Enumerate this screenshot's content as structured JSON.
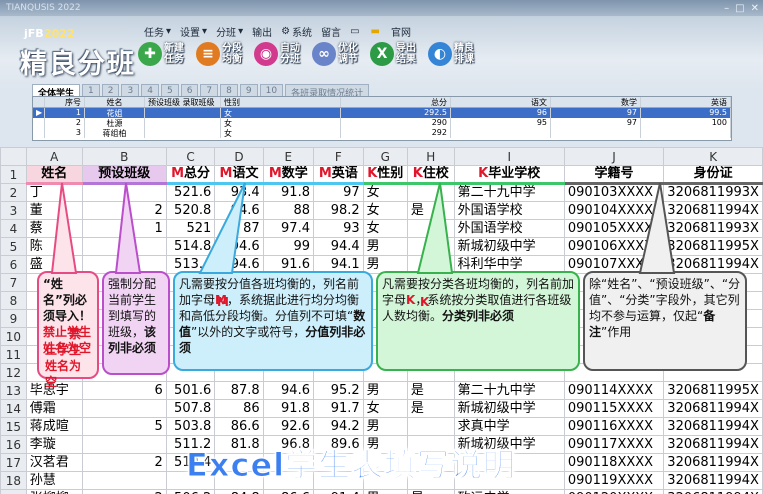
{
  "window": {
    "title": "TIANQUSIS 2022",
    "buttons": [
      "–",
      "□",
      "✕"
    ]
  },
  "brand": {
    "prefix": "jFB",
    "year": "2022",
    "title": "精良分班"
  },
  "menu": [
    {
      "label": "任务",
      "arrow": "▾"
    },
    {
      "label": "设置",
      "arrow": "▾"
    },
    {
      "label": "分班",
      "arrow": "▾"
    },
    {
      "label": "输出",
      "arrow": ""
    },
    {
      "label": "系统",
      "arrow": ""
    },
    {
      "label": "留言",
      "arrow": ""
    },
    {
      "label": "",
      "arrow": ""
    },
    {
      "label": "",
      "arrow": ""
    },
    {
      "label": "官网",
      "arrow": ""
    }
  ],
  "toolbar": [
    {
      "icon": "plus-icon",
      "label": "新建任务",
      "color": "#3aa84a",
      "glyph": "✚"
    },
    {
      "icon": "split-icon",
      "label": "分段均衡",
      "color": "#e07b22",
      "glyph": "≡"
    },
    {
      "icon": "auto-split-icon",
      "label": "自动分班",
      "color": "#d23a8e",
      "glyph": "◉"
    },
    {
      "icon": "optimize-icon",
      "label": "优化调节",
      "color": "#6a84c9",
      "glyph": "∞"
    },
    {
      "icon": "excel-export-icon",
      "label": "导出结果",
      "color": "#2d9a45",
      "glyph": "X"
    },
    {
      "icon": "schedule-icon",
      "label": "精良排课",
      "color": "#3585d6",
      "glyph": "◐"
    }
  ],
  "tabs": [
    "全体学生",
    "1",
    "2",
    "3",
    "4",
    "5",
    "6",
    "7",
    "8",
    "9",
    "10",
    "各班录取情况统计"
  ],
  "inner_grid": {
    "headers": [
      "",
      "序号",
      "姓名",
      "预设班级 录取班级",
      "性别",
      "总分",
      "语文",
      "数学",
      "英语"
    ],
    "rows": [
      [
        "▶",
        "1",
        "花姐",
        "",
        "女",
        "292.5",
        "96",
        "97",
        "99.5"
      ],
      [
        "",
        "2",
        "杜源",
        "",
        "女",
        "290",
        "95",
        "97",
        "100"
      ],
      [
        "",
        "3",
        "蒋组柏",
        "",
        "女",
        "292",
        "",
        "",
        ""
      ]
    ]
  },
  "sheet": {
    "columns": [
      "",
      "A",
      "B",
      "C",
      "D",
      "E",
      "F",
      "G",
      "H",
      "I",
      "J",
      "K"
    ],
    "header_row": {
      "num": "1",
      "cells": [
        "姓名",
        "预设班级",
        "M总分",
        "M语文",
        "M数学",
        "M英语",
        "K性别",
        "K住校",
        "K毕业学校",
        "学籍号",
        "身份证"
      ]
    },
    "rows": [
      {
        "num": "2",
        "cells": [
          "丁",
          "",
          "521.6",
          "93.4",
          "91.8",
          "97",
          "女",
          "",
          "第二十九中学",
          "090103XXXX",
          "3206811993X"
        ]
      },
      {
        "num": "3",
        "cells": [
          "董",
          "2",
          "520.8",
          "94.6",
          "88",
          "98.2",
          "女",
          "是",
          "外国语学校",
          "090104XXXX",
          "3206811994X"
        ]
      },
      {
        "num": "4",
        "cells": [
          "蔡",
          "1",
          "521",
          "87",
          "97.4",
          "93",
          "女",
          "",
          "外国语学校",
          "090105XXXX",
          "3206811993X"
        ]
      },
      {
        "num": "5",
        "cells": [
          "陈",
          "",
          "514.8",
          "94.6",
          "99",
          "94.4",
          "男",
          "",
          "新城初级中学",
          "090106XXXX",
          "3206811995X"
        ]
      },
      {
        "num": "6",
        "cells": [
          "盛",
          "",
          "513.4",
          "94.6",
          "91.6",
          "94.1",
          "男",
          "",
          "科利华中学",
          "090107XXXX",
          "3206811994X"
        ]
      },
      {
        "num": "7",
        "cells": [
          "",
          "",
          "",
          "",
          "",
          "",
          "",
          "",
          "",
          "",
          ""
        ]
      },
      {
        "num": "8",
        "cells": [
          "",
          "",
          "",
          "",
          "",
          "",
          "",
          "",
          "",
          "",
          ""
        ]
      },
      {
        "num": "9",
        "cells": [
          "",
          "",
          "",
          "",
          "",
          "",
          "",
          "",
          "",
          "",
          ""
        ]
      },
      {
        "num": "10",
        "cells": [
          "",
          "",
          "",
          "",
          "",
          "",
          "",
          "",
          "",
          "",
          ""
        ]
      },
      {
        "num": "11",
        "cells": [
          "",
          "",
          "",
          "",
          "",
          "",
          "",
          "",
          "",
          "",
          ""
        ]
      },
      {
        "num": "12",
        "cells": [
          "",
          "",
          "",
          "",
          "",
          "",
          "",
          "",
          "",
          "",
          ""
        ]
      },
      {
        "num": "13",
        "cells": [
          "毕思宇",
          "6",
          "501.6",
          "87.8",
          "94.6",
          "95.2",
          "男",
          "是",
          "第二十九中学",
          "090114XXXX",
          "3206811995X"
        ]
      },
      {
        "num": "14",
        "cells": [
          "傅霜",
          "",
          "507.8",
          "86",
          "91.8",
          "91.7",
          "女",
          "是",
          "新城初级中学",
          "090115XXXX",
          "3206811994X"
        ]
      },
      {
        "num": "15",
        "cells": [
          "蒋成暄",
          "5",
          "503.8",
          "86.6",
          "92.6",
          "94.2",
          "男",
          "",
          "求真中学",
          "090116XXXX",
          "3206811994X"
        ]
      },
      {
        "num": "16",
        "cells": [
          "李璇",
          "",
          "511.2",
          "81.8",
          "96.8",
          "89.6",
          "男",
          "",
          "新城初级中学",
          "090117XXXX",
          "3206811994X"
        ]
      },
      {
        "num": "17",
        "cells": [
          "汉茗君",
          "2",
          "510.4",
          "",
          "",
          "",
          "",
          "",
          "",
          "090118XXXX",
          "3206811994X"
        ]
      },
      {
        "num": "18",
        "cells": [
          "孙慧",
          "",
          "",
          "",
          "",
          "",
          "",
          "",
          "",
          "090119XXXX",
          "3206811994X"
        ]
      },
      {
        "num": "19",
        "cells": [
          "张柳柳",
          "2",
          "506.2",
          "84.8",
          "86.6",
          "91.4",
          "男",
          "是",
          "致远中学",
          "090120XXXX",
          "3206811994X"
        ]
      }
    ]
  },
  "callouts": {
    "name": {
      "pre": "“姓名”列必须导入！",
      "warn": "禁止学生姓名为空"
    },
    "preset": {
      "pre": "强制分配当前学生到填写的班级，",
      "bold": "该列非必须"
    },
    "score": {
      "p1": "凡需要按分值各班均衡的，列名前加字母",
      "m": "M",
      "p2": "，系统据此进行均分均衡和高低分段均衡。分值列不可填“",
      "b1": "数值",
      "p3": "”以外的文字或符号，",
      "b2": "分值列非必须"
    },
    "category": {
      "p1": "凡需要按分类各班均衡的，列名前加字母",
      "k": "K",
      "p2": "，系统按分类取值进行各班级人数均衡。",
      "b": "分类列非必须"
    },
    "other": {
      "p1": "除“姓名”、“预设班级”、“分值”、“分类”字段外，其它列均不参与运算，仅起“",
      "b": "备注",
      "p2": "”作用"
    }
  },
  "caption": "Excel学生表填写说明",
  "colors": {
    "name": "#e64c83",
    "preset": "#ba4ecb",
    "score": "#3aa9dd",
    "category": "#37b24d",
    "other": "#555555",
    "marker": "#e0162b"
  }
}
